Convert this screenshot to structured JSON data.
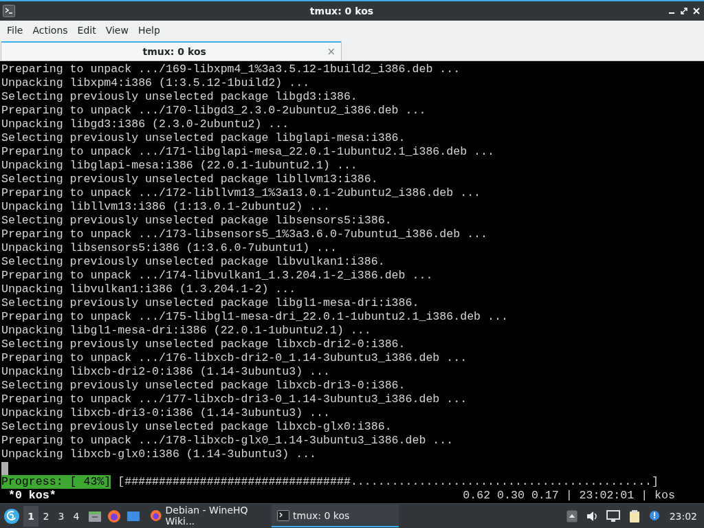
{
  "window": {
    "title": "tmux: 0 kos"
  },
  "menu": [
    "File",
    "Actions",
    "Edit",
    "View",
    "Help"
  ],
  "tabs": [
    {
      "label": "tmux: 0 kos",
      "selected": true,
      "close": "×"
    }
  ],
  "terminal": {
    "lines": [
      "Preparing to unpack .../169-libxpm4_1%3a3.5.12-1build2_i386.deb ...",
      "Unpacking libxpm4:i386 (1:3.5.12-1build2) ...",
      "Selecting previously unselected package libgd3:i386.",
      "Preparing to unpack .../170-libgd3_2.3.0-2ubuntu2_i386.deb ...",
      "Unpacking libgd3:i386 (2.3.0-2ubuntu2) ...",
      "Selecting previously unselected package libglapi-mesa:i386.",
      "Preparing to unpack .../171-libglapi-mesa_22.0.1-1ubuntu2.1_i386.deb ...",
      "Unpacking libglapi-mesa:i386 (22.0.1-1ubuntu2.1) ...",
      "Selecting previously unselected package libllvm13:i386.",
      "Preparing to unpack .../172-libllvm13_1%3a13.0.1-2ubuntu2_i386.deb ...",
      "Unpacking libllvm13:i386 (1:13.0.1-2ubuntu2) ...",
      "Selecting previously unselected package libsensors5:i386.",
      "Preparing to unpack .../173-libsensors5_1%3a3.6.0-7ubuntu1_i386.deb ...",
      "Unpacking libsensors5:i386 (1:3.6.0-7ubuntu1) ...",
      "Selecting previously unselected package libvulkan1:i386.",
      "Preparing to unpack .../174-libvulkan1_1.3.204.1-2_i386.deb ...",
      "Unpacking libvulkan1:i386 (1.3.204.1-2) ...",
      "Selecting previously unselected package libgl1-mesa-dri:i386.",
      "Preparing to unpack .../175-libgl1-mesa-dri_22.0.1-1ubuntu2.1_i386.deb ...",
      "Unpacking libgl1-mesa-dri:i386 (22.0.1-1ubuntu2.1) ...",
      "Selecting previously unselected package libxcb-dri2-0:i386.",
      "Preparing to unpack .../176-libxcb-dri2-0_1.14-3ubuntu3_i386.deb ...",
      "Unpacking libxcb-dri2-0:i386 (1.14-3ubuntu3) ...",
      "Selecting previously unselected package libxcb-dri3-0:i386.",
      "Preparing to unpack .../177-libxcb-dri3-0_1.14-3ubuntu3_i386.deb ...",
      "Unpacking libxcb-dri3-0:i386 (1.14-3ubuntu3) ...",
      "Selecting previously unselected package libxcb-glx0:i386.",
      "Preparing to unpack .../178-libxcb-glx0_1.14-3ubuntu3_i386.deb ...",
      "Unpacking libxcb-glx0:i386 (1.14-3ubuntu3) ..."
    ],
    "progress_label": "Progress: [ 43%]",
    "progress_bar": "[#################################............................................]"
  },
  "tmux_status": {
    "window": "*0 kos*",
    "right": "0.62 0.30 0.17 | 23:02:01 | kos"
  },
  "taskbar": {
    "workspaces": [
      {
        "label": "1",
        "selected": true
      },
      {
        "label": "2",
        "selected": false
      },
      {
        "label": "3",
        "selected": false
      },
      {
        "label": "4",
        "selected": false
      }
    ],
    "tasks": [
      {
        "label": "Debian - WineHQ Wiki...",
        "kind": "browser",
        "selected": false
      },
      {
        "label": "tmux: 0 kos",
        "kind": "terminal",
        "selected": true
      }
    ],
    "clock": "23:02"
  }
}
